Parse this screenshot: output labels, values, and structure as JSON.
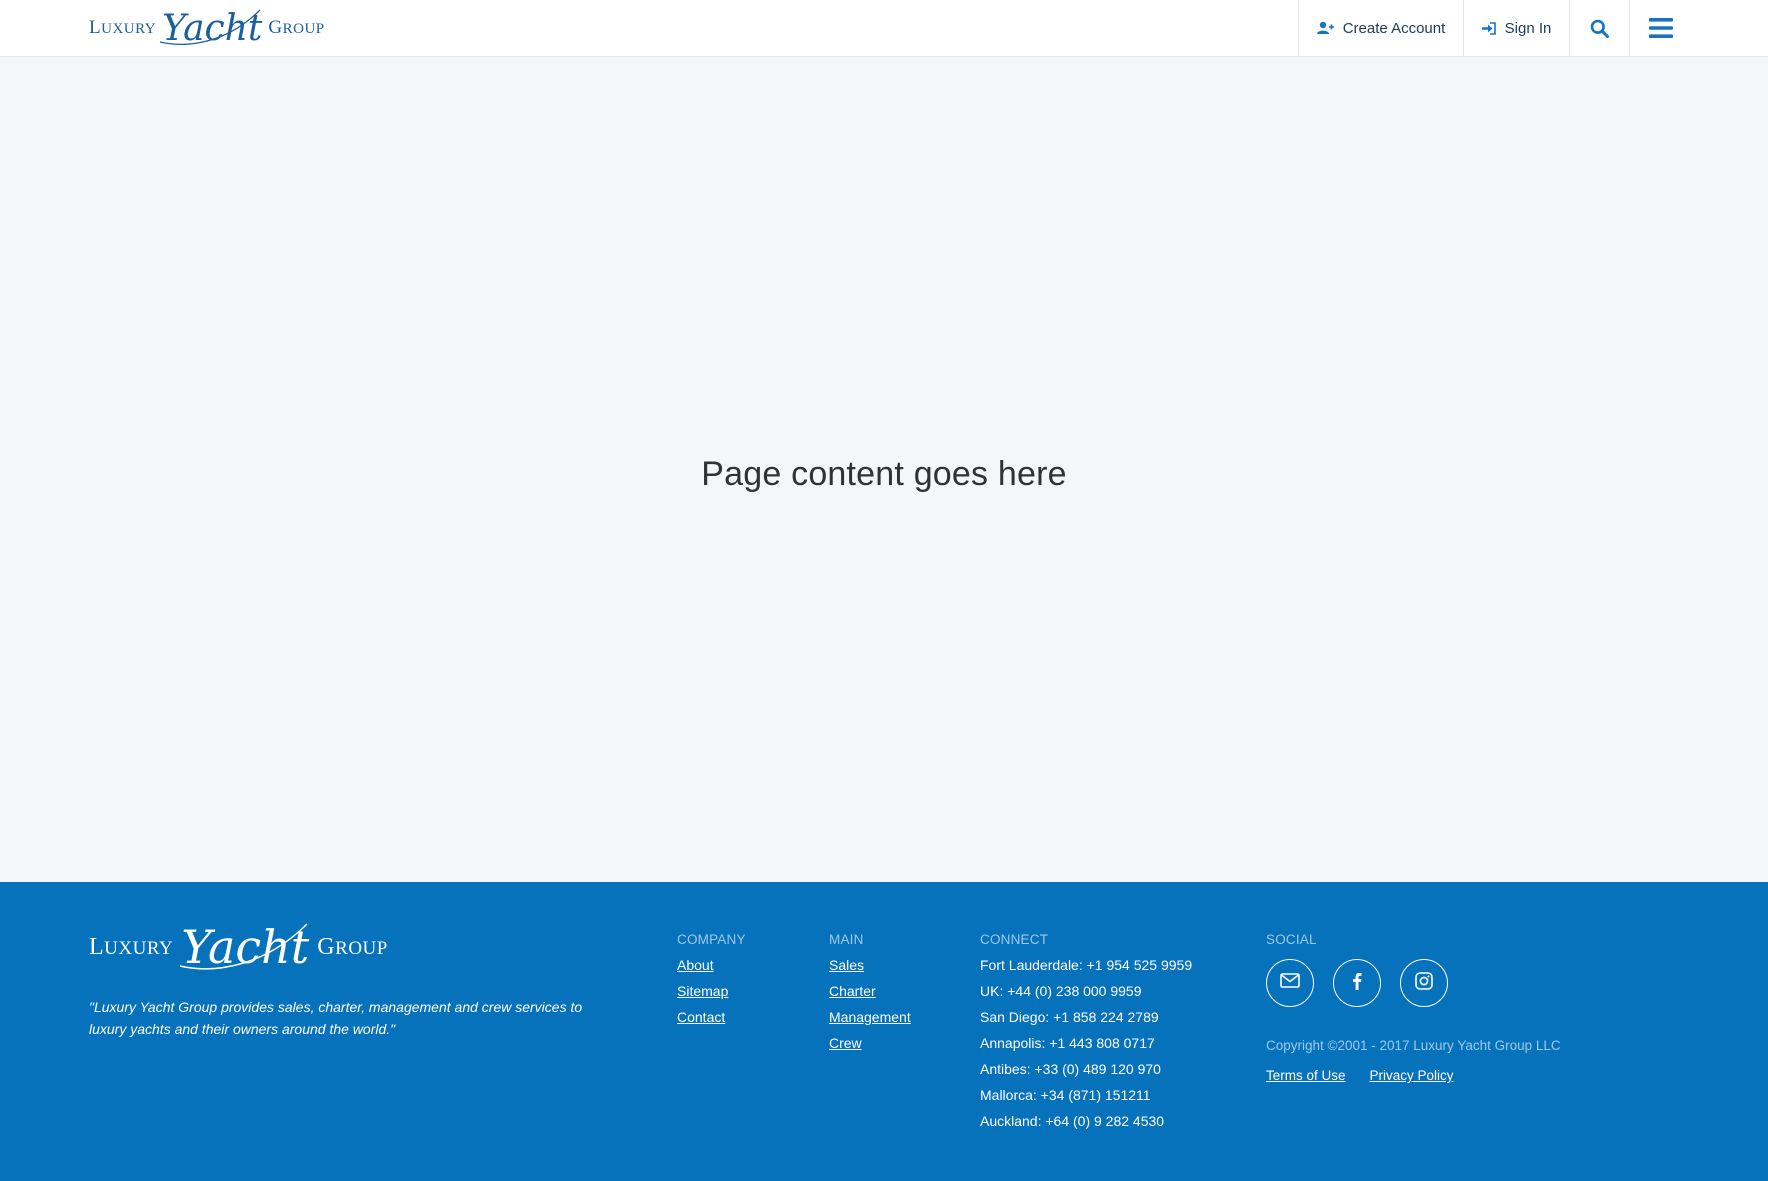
{
  "brand": {
    "word1_first": "L",
    "word1_rest": "uxury",
    "word2": "Yacht",
    "word3_first": "G",
    "word3_rest": "roup"
  },
  "header": {
    "nav": {
      "create_account": "Create Account",
      "sign_in": "Sign In"
    }
  },
  "main": {
    "placeholder": "Page content goes here"
  },
  "footer": {
    "tagline": "\"Luxury Yacht Group provides sales, charter, management and crew services to luxury yachts and their owners around the world.\"",
    "company": {
      "heading": "COMPANY",
      "links": [
        "About",
        "Sitemap",
        "Contact"
      ]
    },
    "main": {
      "heading": "MAIN",
      "links": [
        "Sales",
        "Charter",
        "Management",
        "Crew"
      ]
    },
    "connect": {
      "heading": "CONNECT",
      "lines": [
        "Fort Lauderdale: +1 954 525 9959",
        "UK: +44 (0) 238 000 9959",
        "San Diego: +1 858 224 2789",
        "Annapolis: +1 443 808 0717",
        "Antibes: +33 (0) 489 120 970",
        "Mallorca: +34 (871) 151211",
        "Auckland: +64 (0) 9 282 4530"
      ]
    },
    "social": {
      "heading": "SOCIAL",
      "icons": [
        "envelope-icon",
        "facebook-icon",
        "instagram-icon"
      ]
    },
    "copyright": "Copyright ©2001 - 2017 Luxury Yacht Group LLC",
    "legal": {
      "terms": "Terms of Use",
      "privacy": "Privacy Policy"
    }
  },
  "colors": {
    "brand_blue": "#0672bc",
    "accent_blue": "#1675c2",
    "main_bg": "#f3f7fa"
  }
}
